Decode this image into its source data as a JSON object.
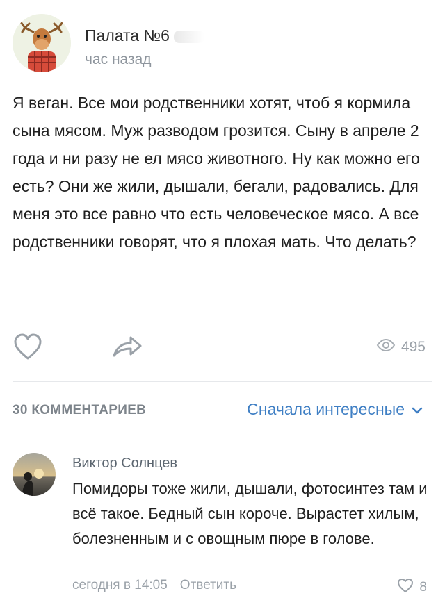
{
  "post": {
    "author": "Палата №6",
    "time": "час назад",
    "text": "Я веган. Все мои родственники хотят, чтоб я кормила сына мясом. Муж разводом грозится. Сыну в апреле 2 года и ни разу не ел мясо животного. Ну как можно его есть? Они же жили, дышали, бегали, радовались. Для меня это все равно что есть человеческое мясо. А все родственники говорят, что я плохая мать. Что делать?",
    "views": "495"
  },
  "comments_bar": {
    "count_label": "30 КОММЕНТАРИЕВ",
    "sort_label": "Сначала интересные"
  },
  "comment": {
    "author": "Виктор Солнцев",
    "text": "Помидоры тоже жили, дышали, фотосинтез там и всё такое. Бедный сын короче. Вырастет хилым, болезненным и с овощным пюре в голове.",
    "time": "сегодня в 14:05",
    "reply_label": "Ответить",
    "likes": "8"
  },
  "colors": {
    "accent": "#3f7fc4",
    "muted": "#9aa1a8"
  },
  "icons": [
    "moose-avatar-icon",
    "heart-icon",
    "share-arrow-icon",
    "eye-icon",
    "chevron-down-icon",
    "sunset-avatar-icon"
  ]
}
